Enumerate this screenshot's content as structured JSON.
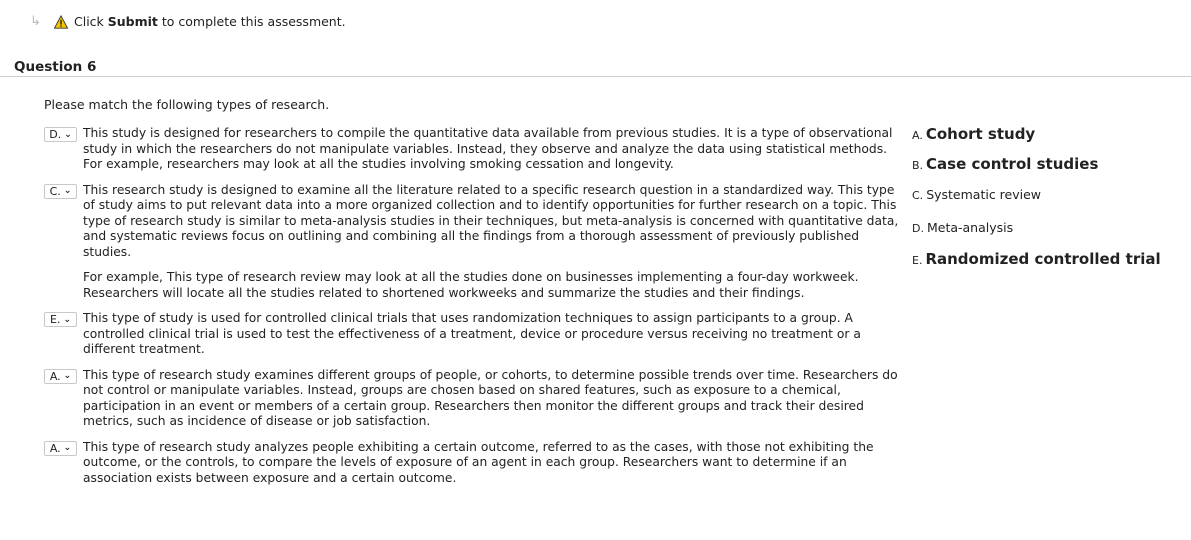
{
  "notice": {
    "pre": "Click ",
    "bold": "Submit",
    "post": " to complete this assessment."
  },
  "question": {
    "title": "Question 6",
    "prompt": "Please match the following types of research."
  },
  "items": [
    {
      "selected": "D.",
      "paragraphs": [
        "This study is designed for researchers to compile the quantitative data available from previous studies. It is a type of observational study in which the researchers do not manipulate variables. Instead, they observe and analyze the data using statistical methods. For example, researchers may look at all the studies involving smoking cessation and longevity."
      ]
    },
    {
      "selected": "C.",
      "paragraphs": [
        "This research study is designed to examine all the literature related to a specific research question in a standardized way. This type of study aims to put relevant data into a more organized collection and to identify opportunities for further research on a topic. This type of research study is similar to meta-analysis studies in their techniques, but meta-analysis is concerned with quantitative data, and systematic reviews focus on outlining and combining all the findings from a thorough assessment of previously published studies.",
        "For example, This type of research review may look at all the studies done on businesses implementing a four-day workweek. Researchers will locate all the studies related to shortened workweeks and summarize the studies and their findings."
      ]
    },
    {
      "selected": "E.",
      "paragraphs": [
        "This type of study is used for controlled clinical trials that uses randomization techniques to assign participants to a group. A controlled clinical trial is used to test the effectiveness of a treatment, device or procedure versus receiving no treatment or a different treatment."
      ]
    },
    {
      "selected": "A.",
      "paragraphs": [
        "This type of research study examines different groups of people, or cohorts, to determine possible trends over time. Researchers do not control or manipulate variables. Instead, groups are chosen based on shared features, such as exposure to a chemical, participation in an event or members of a certain group. Researchers then monitor the different groups and track their desired metrics, such as incidence of disease or job satisfaction."
      ]
    },
    {
      "selected": "A.",
      "paragraphs": [
        "This type of research study analyzes people exhibiting a certain outcome, referred to as the cases, with those not exhibiting the outcome, or the controls, to compare the levels of exposure of an agent in each group. Researchers want to determine if an association exists between exposure and a certain outcome."
      ]
    }
  ],
  "answers": [
    {
      "letter": "A.",
      "text": "Cohort study"
    },
    {
      "letter": "B.",
      "text": "Case control studies"
    },
    {
      "letter": "C.",
      "text": "Systematic review"
    },
    {
      "letter": "D.",
      "text": "Meta-analysis"
    },
    {
      "letter": "E.",
      "text": "Randomized controlled trial"
    }
  ]
}
